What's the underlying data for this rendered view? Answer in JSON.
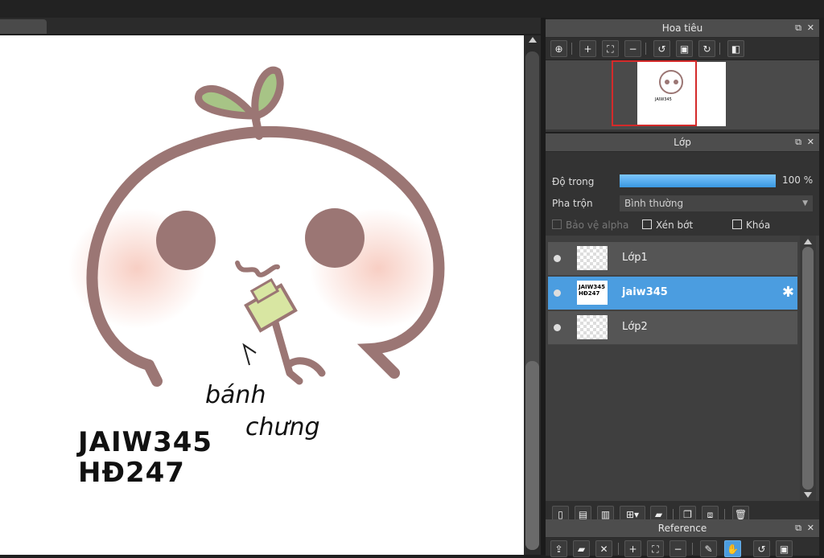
{
  "canvas": {
    "annotation_line1": "bánh",
    "annotation_line2": "chưng",
    "watermark_line1": "JAIW345",
    "watermark_line2": "HĐ247"
  },
  "navigator": {
    "title": "Hoa tiêu",
    "tools": [
      "zoom-fit-icon",
      "zoom-in-icon",
      "fit-window-icon",
      "zoom-out-icon",
      "rotate-left-icon",
      "reset-view-icon",
      "rotate-right-icon",
      "flip-icon"
    ]
  },
  "layers_panel": {
    "title": "Lớp",
    "opacity_label": "Độ trong",
    "opacity_value": "100 %",
    "opacity": 1.0,
    "blend_label": "Pha trộn",
    "blend_value": "Bình thường",
    "protect_alpha": "Bảo vệ alpha",
    "clipping": "Xén bớt",
    "lock": "Khóa",
    "layers": [
      {
        "name": "Lớp1",
        "selected": false
      },
      {
        "name": "jaiw345",
        "selected": true,
        "thumb_text_1": "JAIW345",
        "thumb_text_2": "HĐ247"
      },
      {
        "name": "Lớp2",
        "selected": false
      }
    ]
  },
  "reference": {
    "title": "Reference"
  },
  "colors": {
    "accent": "#4b9de0",
    "outline": "#9b7674",
    "leaf": "#a7c486",
    "blush": "#f7c9bd"
  }
}
